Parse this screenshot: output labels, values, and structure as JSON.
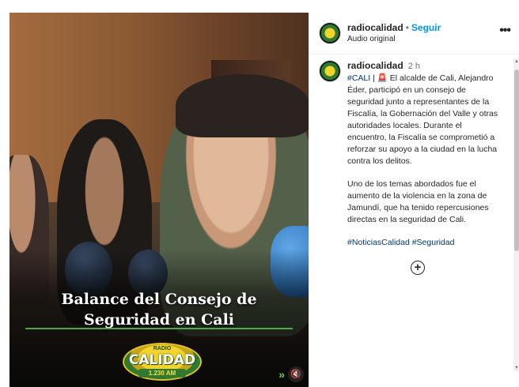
{
  "post": {
    "account": "radiocalidad",
    "follow_label": "Seguir",
    "separator": "•",
    "audio_label": "Audio original",
    "more_icon": "more-horizontal-icon"
  },
  "media": {
    "caption_line1": "Balance del Consejo de",
    "caption_line2": "Seguridad en Cali",
    "logo_top": "RADIO",
    "logo_mid": "CALIDAD",
    "logo_bottom": "1.230 AM",
    "mute_icon": "speaker-muted-icon",
    "brand_color": "#2f7a2f",
    "accent_color": "#f2d42b"
  },
  "comment": {
    "author": "radiocalidad",
    "time": "2 h",
    "hashtag_cali": "#CALI",
    "pipe": "|",
    "alarm_icon": "🚨",
    "paragraph1": "El alcalde de Cali, Alejandro Éder, participó en un consejo de seguridad junto a representantes de la Fiscalía, la Gobernación del Valle y otras autoridades locales. Durante el encuentro, la Fiscalía se comprometió a reforzar su apoyo a la ciudad en la lucha contra los delitos.",
    "paragraph2": "Uno de los temas abordados fue el aumento de la violencia en la zona de Jamundí, que ha tenido repercusiones directas en la seguridad de Cali.",
    "hashtags": "#NoticiasCalidad #Seguridad",
    "expand_icon": "+"
  },
  "colors": {
    "link": "#0095f6",
    "hashtag": "#00376b",
    "text": "#262626",
    "muted": "#737373"
  }
}
